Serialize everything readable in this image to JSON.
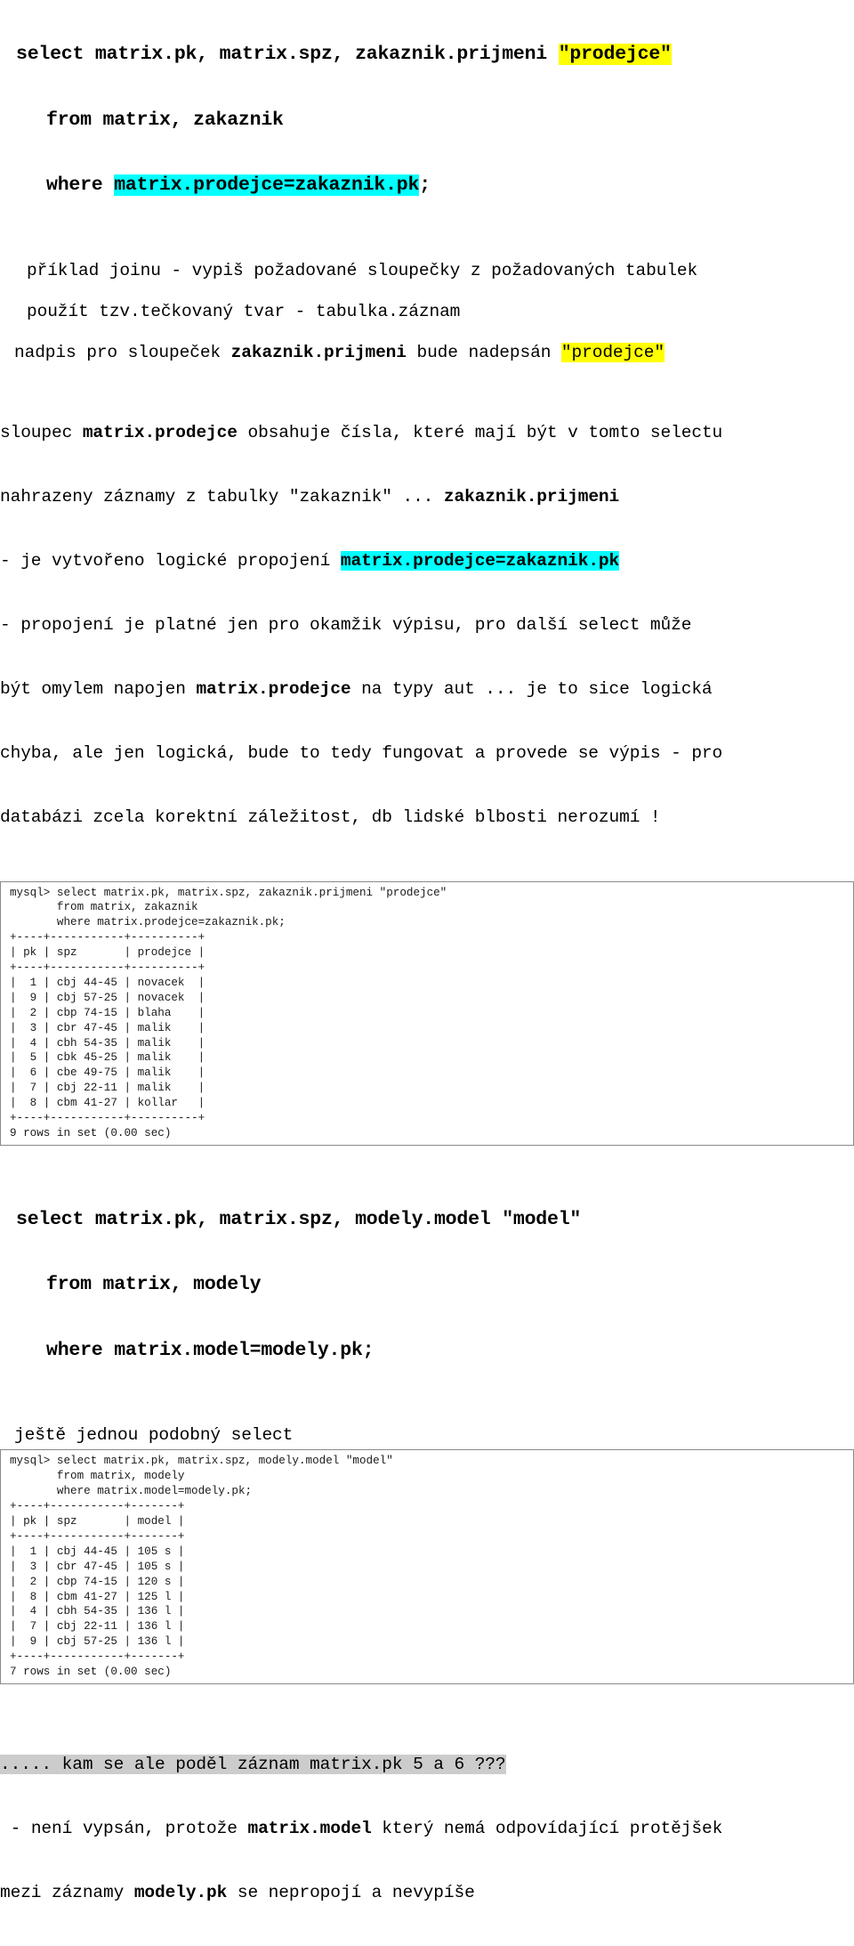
{
  "document": {
    "language": "cs",
    "colors": {
      "highlight_yellow": "#ffff00",
      "highlight_cyan": "#00ffff",
      "highlight_gray": "#cccccc",
      "text": "#000000",
      "terminal_border": "#8a8a8a"
    }
  },
  "sql_block_1": {
    "line1_a": "select matrix.pk, matrix.spz, zakaznik.prijmeni ",
    "line1_hl": "\"prodejce\"",
    "line2": "from matrix, zakaznik",
    "line3_a": "where ",
    "line3_hl": "matrix.prodejce=zakaznik.pk",
    "line3_b": ";"
  },
  "notes": {
    "note1": "příklad joinu - vypiš požadované sloupečky z požadovaných tabulek",
    "note2": "použít tzv.tečkovaný tvar - tabulka.záznam",
    "note3_a": "nadpis pro sloupeček ",
    "note3_b": "zakaznik.prijmeni",
    "note3_c": " bude nadepsán ",
    "note3_hl": "\"prodejce\""
  },
  "explanation": {
    "l1_a": "sloupec ",
    "l1_b": "matrix.prodejce",
    "l1_c": " obsahuje čísla, které mají být v tomto selectu",
    "l2_a": "nahrazeny záznamy z tabulky \"zakaznik\" ... ",
    "l2_b": "zakaznik.prijmeni",
    "l3_a": "- je vytvořeno logické propojení ",
    "l3_hl": "matrix.prodejce=zakaznik.pk",
    "l4": "- propojení je platné jen pro okamžik výpisu, pro další select může",
    "l5_a": "být omylem napojen ",
    "l5_b": "matrix.prodejce",
    "l5_c": " na typy aut ... je to sice logická",
    "l6": "chyba, ale jen logická, bude to tedy fungovat a provede se výpis - pro",
    "l7": "databázi zcela korektní záležitost, db lidské blbosti nerozumí !"
  },
  "terminal_1": {
    "prompt_line": "mysql> select matrix.pk, matrix.spz, zakaznik.prijmeni \"prodejce\"",
    "cont_line_1": "       from matrix, zakaznik",
    "cont_line_2": "       where matrix.prodejce=zakaznik.pk;",
    "rule": "+----+-----------+----------+",
    "header": "| pk | spz       | prodejce |",
    "rows": [
      "|  1 | cbj 44-45 | novacek  |",
      "|  9 | cbj 57-25 | novacek  |",
      "|  2 | cbp 74-15 | blaha    |",
      "|  3 | cbr 47-45 | malik    |",
      "|  4 | cbh 54-35 | malik    |",
      "|  5 | cbk 45-25 | malik    |",
      "|  6 | cbe 49-75 | malik    |",
      "|  7 | cbj 22-11 | malik    |",
      "|  8 | cbm 41-27 | kollar   |"
    ],
    "footer": "9 rows in set (0.00 sec)"
  },
  "sql_block_2": {
    "line1": "select matrix.pk, matrix.spz, modely.model \"model\"",
    "line2": "from matrix, modely",
    "line3": "where matrix.model=modely.pk;"
  },
  "notes2": {
    "note1": "ještě jednou podobný select"
  },
  "terminal_2": {
    "prompt_line": "mysql> select matrix.pk, matrix.spz, modely.model \"model\"",
    "cont_line_1": "       from matrix, modely",
    "cont_line_2": "       where matrix.model=modely.pk;",
    "rule": "+----+-----------+-------+",
    "header": "| pk | spz       | model |",
    "rows": [
      "|  1 | cbj 44-45 | 105 s |",
      "|  3 | cbr 47-45 | 105 s |",
      "|  2 | cbp 74-15 | 120 s |",
      "|  8 | cbm 41-27 | 125 l |",
      "|  4 | cbh 54-35 | 136 l |",
      "|  7 | cbj 22-11 | 136 l |",
      "|  9 | cbj 57-25 | 136 l |"
    ],
    "footer": "7 rows in set (0.00 sec)"
  },
  "conclusion": {
    "l1_hl": "..... kam se ale poděl záznam matrix.pk 5 a 6 ???",
    "l2_a": " - není vypsán, protože ",
    "l2_b": "matrix.model",
    "l2_c": " který nemá odpovídající protějšek",
    "l3_a": "mezi záznamy ",
    "l3_b": "modely.pk",
    "l3_c": " se nepropojí a nevypíše"
  }
}
